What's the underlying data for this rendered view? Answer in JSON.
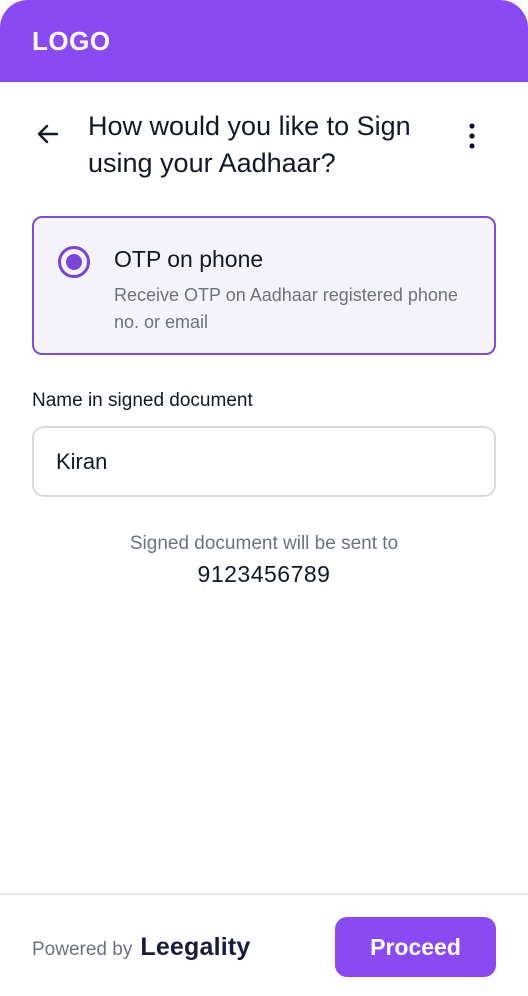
{
  "header": {
    "logo_text": "LOGO"
  },
  "page": {
    "title": "How would you like to Sign using your Aadhaar?",
    "back_icon": "arrow-left-icon",
    "more_icon": "more-vertical-icon"
  },
  "option": {
    "title": "OTP on phone",
    "description": "Receive OTP on Aadhaar registered phone no. or email",
    "selected": true
  },
  "name_field": {
    "label": "Name in signed document",
    "value": "Kiran"
  },
  "delivery": {
    "text": "Signed document will be sent to",
    "phone": "9123456789"
  },
  "footer": {
    "powered_by": "Powered by",
    "brand": "Leegality",
    "proceed_label": "Proceed"
  },
  "colors": {
    "primary": "#8a4af3",
    "radio": "#7a44d8",
    "card_bg": "#f4f3f9",
    "muted_text": "#6b7280"
  }
}
